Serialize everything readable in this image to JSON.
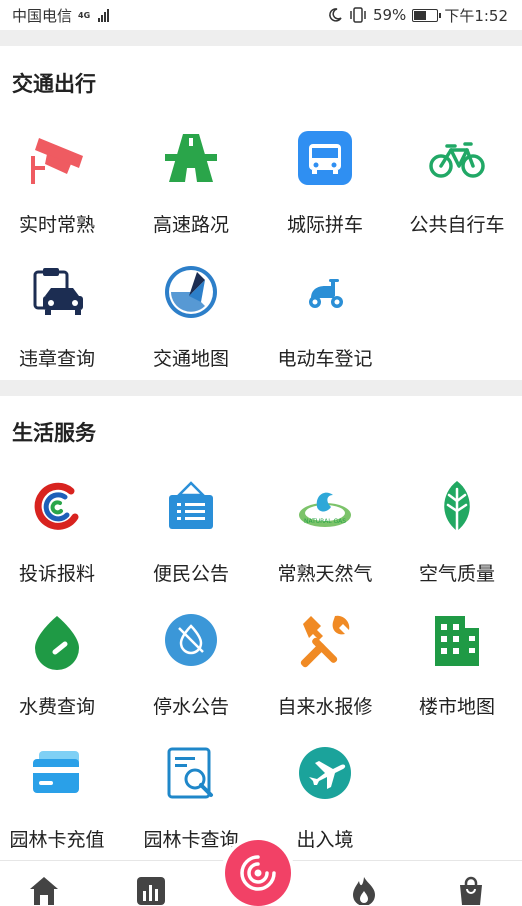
{
  "status_bar": {
    "carrier": "中国电信",
    "network": "4G",
    "battery": "59%",
    "battery_level": 0.59,
    "time": "下午1:52"
  },
  "sections": [
    {
      "title": "交通出行",
      "items": [
        {
          "label": "实时常熟",
          "icon": "cctv-camera-icon",
          "color": "#ef5b61"
        },
        {
          "label": "高速路况",
          "icon": "highway-icon",
          "color": "#2aa54a"
        },
        {
          "label": "城际拼车",
          "icon": "bus-icon",
          "color": "#2f8ff2"
        },
        {
          "label": "公共自行车",
          "icon": "bicycle-icon",
          "color": "#21a866"
        },
        {
          "label": "违章查询",
          "icon": "car-clipboard-icon",
          "color": "#1c2d52"
        },
        {
          "label": "交通地图",
          "icon": "map-compass-icon",
          "color": "#2d7fc9"
        },
        {
          "label": "电动车登记",
          "icon": "scooter-icon",
          "color": "#2b8fd6"
        }
      ]
    },
    {
      "title": "生活服务",
      "items": [
        {
          "label": "投诉报料",
          "icon": "complaint-logo-icon",
          "color": "#d8231f"
        },
        {
          "label": "便民公告",
          "icon": "notice-board-icon",
          "color": "#2a8fd8"
        },
        {
          "label": "常熟天然气",
          "icon": "natural-gas-logo-icon",
          "color": "#2ea8d8"
        },
        {
          "label": "空气质量",
          "icon": "leaf-icon",
          "color": "#22a862"
        },
        {
          "label": "水费查询",
          "icon": "water-drop-icon",
          "color": "#1f9a45"
        },
        {
          "label": "停水公告",
          "icon": "no-water-icon",
          "color": "#3b97d8"
        },
        {
          "label": "自来水报修",
          "icon": "repair-tools-icon",
          "color": "#f08a24"
        },
        {
          "label": "楼市地图",
          "icon": "building-icon",
          "color": "#1f9a45"
        },
        {
          "label": "园林卡充值",
          "icon": "card-icon",
          "color": "#2aa0e8"
        },
        {
          "label": "园林卡查询",
          "icon": "document-search-icon",
          "color": "#1f87c9"
        },
        {
          "label": "出入境",
          "icon": "airplane-icon",
          "color": "#1ba39b"
        }
      ]
    }
  ],
  "tab_bar": {
    "tabs": [
      {
        "icon": "home-icon"
      },
      {
        "icon": "chart-icon"
      },
      {
        "icon": "radar-icon",
        "color": "#f24166"
      },
      {
        "icon": "flame-icon"
      },
      {
        "icon": "bag-icon"
      }
    ]
  }
}
